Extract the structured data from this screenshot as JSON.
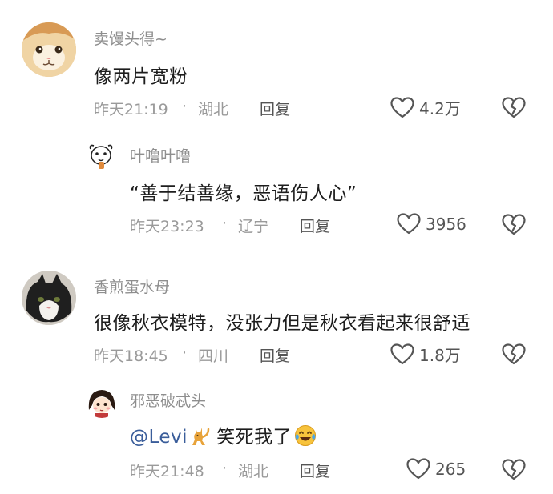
{
  "comments": [
    {
      "username": "卖馒头得~",
      "text": "像两片宽粉",
      "time": "昨天21:19",
      "location": "湖北",
      "separator": "·",
      "reply_label": "回复",
      "likes": "4.2万",
      "avatar_icon": "cat-face-avatar"
    },
    {
      "username": "叶噜叶噜",
      "text": "“善于结善缘，恶语伤人心”",
      "time": "昨天23:23",
      "location": "辽宁",
      "separator": "·",
      "reply_label": "回复",
      "likes": "3956",
      "avatar_icon": "dog-doodle-avatar"
    },
    {
      "username": "香煎蛋水母",
      "text": "很像秋衣模特，没张力但是秋衣看起来很舒适",
      "time": "昨天18:45",
      "location": "四川",
      "separator": "·",
      "reply_label": "回复",
      "likes": "1.8万",
      "avatar_icon": "black-white-cat-avatar"
    },
    {
      "username": "邪恶破忒头",
      "mention": "@Levi",
      "text": "笑死我了",
      "time": "昨天21:48",
      "location": "湖北",
      "separator": "·",
      "reply_label": "回复",
      "likes": "265",
      "avatar_icon": "cartoon-girl-avatar"
    }
  ],
  "colors": {
    "meta_gray": "#9a9a9a",
    "text": "#1d1d1d",
    "mention": "#3a5d9a",
    "icon": "#555555"
  }
}
